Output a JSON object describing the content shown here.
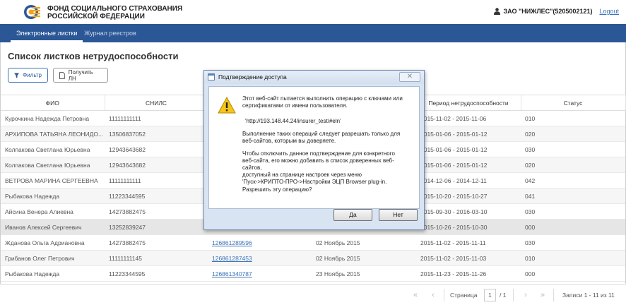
{
  "header": {
    "org_line1": "ФОНД СОЦИАЛЬНОГО СТРАХОВАНИЯ",
    "org_line2": "РОССИЙСКОЙ ФЕДЕРАЦИИ",
    "user": "ЗАО \"НИЖЛЕС\"(5205002121)",
    "logout": "Logout"
  },
  "nav": {
    "tabs": [
      {
        "label": "Электронные листки",
        "active": true
      },
      {
        "label": "Журнал реестров",
        "active": false
      }
    ]
  },
  "page": {
    "title": "Список листков нетрудоспособности",
    "filter_button": "Фильтр",
    "get_button": "Получить ЛН"
  },
  "table": {
    "columns": [
      "ФИО",
      "СНИЛС",
      "",
      "",
      "Период нетрудоспособности",
      "Статус"
    ],
    "rows": [
      {
        "fio": "Курочкина Надежда Петровна",
        "snils": "11111111111",
        "ln": "",
        "date": "",
        "period": "2015-11-02 - 2015-11-06",
        "status": "010"
      },
      {
        "fio": "АРХИПОВА ТАТЬЯНА ЛЕОНИДО...",
        "snils": "13506837052",
        "ln": "",
        "date": "",
        "period": "2015-01-06 - 2015-01-12",
        "status": "020"
      },
      {
        "fio": "Колпакова Светлана Юрьевна",
        "snils": "12943643682",
        "ln": "",
        "date": "",
        "period": "2015-01-06 - 2015-01-12",
        "status": "030"
      },
      {
        "fio": "Колпакова Светлана Юрьевна",
        "snils": "12943643682",
        "ln": "",
        "date": "",
        "period": "2015-01-06 - 2015-01-12",
        "status": "020"
      },
      {
        "fio": "ВЕТРОВА МАРИНА СЕРГЕЕВНА",
        "snils": "11111111111",
        "ln": "",
        "date": "",
        "period": "2014-12-06 - 2014-12-11",
        "status": "042"
      },
      {
        "fio": "Рыбакова Надежда",
        "snils": "11223344595",
        "ln": "",
        "date": "",
        "period": "2015-10-20 - 2015-10-27",
        "status": "041"
      },
      {
        "fio": "Айсина Венера Алиевна",
        "snils": "14273882475",
        "ln": "",
        "date": "",
        "period": "2015-09-30 - 2016-03-10",
        "status": "030"
      },
      {
        "fio": "Иванов Алексей Сергеевич",
        "snils": "13252839247",
        "ln": "",
        "date": "",
        "period": "2015-10-26 - 2015-10-30",
        "status": "000"
      },
      {
        "fio": "Жданова Ольга Адриановна",
        "snils": "14273882475",
        "ln": "126861289596",
        "date": "02 Ноябрь 2015",
        "period": "2015-11-02 - 2015-11-11",
        "status": "030"
      },
      {
        "fio": "Грибанов Олег Петрович",
        "snils": "11111111145",
        "ln": "126861287453",
        "date": "02 Ноябрь 2015",
        "period": "2015-11-02 - 2015-11-03",
        "status": "010"
      },
      {
        "fio": "Рыбакова Надежда",
        "snils": "11223344595",
        "ln": "126861340787",
        "date": "23 Ноябрь 2015",
        "period": "2015-11-23 - 2015-11-26",
        "status": "000"
      }
    ]
  },
  "pagination": {
    "page_label": "Страница",
    "page_value": "1",
    "of_label": "/ 1",
    "records": "Записи 1 - 11 из 11"
  },
  "dialog": {
    "title": "Подтверждение доступа",
    "close": "✕",
    "text1_line1": "Этот веб-сайт пытается выполнить операцию с ключами или",
    "text1_line2": "сертификатами от имени пользователя.",
    "url": "'http://193.148.44.24/insurer_test/#eln'",
    "text2_line1": "Выполнение таких операций следует разрешать только для",
    "text2_line2": "веб-сайтов, которым вы доверяете.",
    "text3_line1": "Чтобы отключить данное подтверждение для конкретного",
    "text3_line2": "веб-сайта, его можно добавить в список доверенных веб-сайтов,",
    "text3_line3": "доступный на странице настроек через меню",
    "text3_line4": "'Пуск->КРИПТО-ПРО->Настройки ЭЦП Browser plug-in.",
    "question": "Разрешить эту операцию?",
    "yes": "Да",
    "no": "Нет"
  },
  "colors": {
    "navbar": "#2b5797",
    "link": "#3b73b9"
  }
}
